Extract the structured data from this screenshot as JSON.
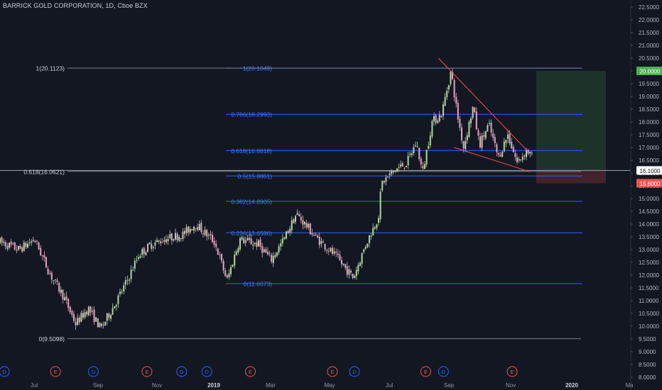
{
  "chart_data": {
    "type": "candlestick",
    "title": "BARRICK GOLD CORPORATION, 1D, Cboe BZX",
    "ylim": [
      8.0,
      22.5
    ],
    "y_ticks": [
      "22.5000",
      "22.0000",
      "21.5000",
      "21.0000",
      "20.5000",
      "20.0000",
      "19.5000",
      "19.0000",
      "18.5000",
      "18.0000",
      "17.5000",
      "17.0000",
      "16.5000",
      "16.0000",
      "15.5000",
      "15.0000",
      "14.5000",
      "14.0000",
      "13.5000",
      "13.0000",
      "12.5000",
      "12.0000",
      "11.5000",
      "11.0000",
      "10.5000",
      "10.0000",
      "9.5000",
      "9.0000",
      "8.5000",
      "8.0000"
    ],
    "x_ticks": [
      "Jul",
      "Sep",
      "Nov",
      "2019",
      "Mar",
      "May",
      "Jul",
      "Sep",
      "Nov",
      "2020",
      "Ma"
    ],
    "price_path": [
      {
        "t": 0,
        "p": 13.3
      },
      {
        "t": 0.03,
        "p": 13.0
      },
      {
        "t": 0.055,
        "p": 13.4
      },
      {
        "t": 0.08,
        "p": 12.0
      },
      {
        "t": 0.1,
        "p": 11.2
      },
      {
        "t": 0.12,
        "p": 10.1
      },
      {
        "t": 0.14,
        "p": 10.7
      },
      {
        "t": 0.16,
        "p": 9.9
      },
      {
        "t": 0.185,
        "p": 11.0
      },
      {
        "t": 0.2,
        "p": 11.7
      },
      {
        "t": 0.22,
        "p": 12.8
      },
      {
        "t": 0.24,
        "p": 13.2
      },
      {
        "t": 0.26,
        "p": 13.4
      },
      {
        "t": 0.29,
        "p": 13.6
      },
      {
        "t": 0.31,
        "p": 14.0
      },
      {
        "t": 0.34,
        "p": 13.3
      },
      {
        "t": 0.36,
        "p": 11.8
      },
      {
        "t": 0.38,
        "p": 13.4
      },
      {
        "t": 0.41,
        "p": 13.2
      },
      {
        "t": 0.43,
        "p": 12.6
      },
      {
        "t": 0.45,
        "p": 13.4
      },
      {
        "t": 0.47,
        "p": 14.4
      },
      {
        "t": 0.5,
        "p": 13.5
      },
      {
        "t": 0.53,
        "p": 12.8
      },
      {
        "t": 0.56,
        "p": 11.9
      },
      {
        "t": 0.58,
        "p": 13.2
      },
      {
        "t": 0.6,
        "p": 14.3
      },
      {
        "t": 0.605,
        "p": 15.6
      },
      {
        "t": 0.625,
        "p": 16.1
      },
      {
        "t": 0.645,
        "p": 16.4
      },
      {
        "t": 0.66,
        "p": 17.2
      },
      {
        "t": 0.67,
        "p": 16.0
      },
      {
        "t": 0.685,
        "p": 18.0
      },
      {
        "t": 0.7,
        "p": 18.3
      },
      {
        "t": 0.715,
        "p": 20.0
      },
      {
        "t": 0.725,
        "p": 18.3
      },
      {
        "t": 0.735,
        "p": 17.0
      },
      {
        "t": 0.75,
        "p": 18.6
      },
      {
        "t": 0.76,
        "p": 17.1
      },
      {
        "t": 0.775,
        "p": 17.9
      },
      {
        "t": 0.79,
        "p": 16.6
      },
      {
        "t": 0.805,
        "p": 17.5
      },
      {
        "t": 0.82,
        "p": 16.4
      },
      {
        "t": 0.835,
        "p": 16.9
      },
      {
        "t": 0.845,
        "p": 16.6
      }
    ],
    "fib_retracement_current": {
      "levels": [
        {
          "label": "1(20.1049)",
          "price": 20.1049
        },
        {
          "label": "0.786(18.2993)",
          "price": 18.2993
        },
        {
          "label": "0.618(16.8818)",
          "price": 16.8818
        },
        {
          "label": "0.5(15.8861)",
          "price": 15.8861
        },
        {
          "label": "0.382(14.8905)",
          "price": 14.8905
        },
        {
          "label": "0.236(13.6586)",
          "price": 13.6586
        },
        {
          "label": "0(11.6673)",
          "price": 11.6673
        }
      ],
      "color": "#2962ff"
    },
    "fib_retracement_prior": {
      "levels": [
        {
          "label": "1(20.1123)",
          "price": 20.1123
        },
        {
          "label": "0.618(16.0621)",
          "price": 16.0621
        },
        {
          "label": "0(9.5098)",
          "price": 9.5098
        }
      ],
      "color": "#787b86"
    },
    "wedge_lines": {
      "upper": [
        {
          "t": 0.695,
          "p": 20.5
        },
        {
          "t": 0.835,
          "p": 16.9
        }
      ],
      "lower": [
        {
          "t": 0.72,
          "p": 17.0
        },
        {
          "t": 0.84,
          "p": 16.05
        }
      ],
      "color": "#ef5350"
    },
    "position": {
      "entry": 16.1,
      "target": 20.0,
      "stop": 15.6,
      "entry_label": "16.1000",
      "target_label": "20.0000",
      "stop_label": "15.6000",
      "target_color": "#4caf50",
      "stop_color": "#ef5350"
    },
    "event_markers": [
      {
        "type": "D",
        "t": 0.0
      },
      {
        "type": "E",
        "t": 0.088
      },
      {
        "type": "D",
        "t": 0.148
      },
      {
        "type": "E",
        "t": 0.233
      },
      {
        "type": "D",
        "t": 0.288
      },
      {
        "type": "D",
        "t": 0.328
      },
      {
        "type": "E",
        "t": 0.397
      },
      {
        "type": "E",
        "t": 0.527
      },
      {
        "type": "D",
        "t": 0.562
      },
      {
        "type": "E",
        "t": 0.675
      },
      {
        "type": "D",
        "t": 0.703
      },
      {
        "type": "E",
        "t": 0.812
      }
    ],
    "colors": {
      "background": "#131722",
      "up": "#26a69a",
      "down": "#ef5350",
      "candle_up_light": "#b5d3a4",
      "candle_down_light": "#e2a5c0",
      "dividend": "#2962ff",
      "earnings": "#ef5350"
    }
  }
}
